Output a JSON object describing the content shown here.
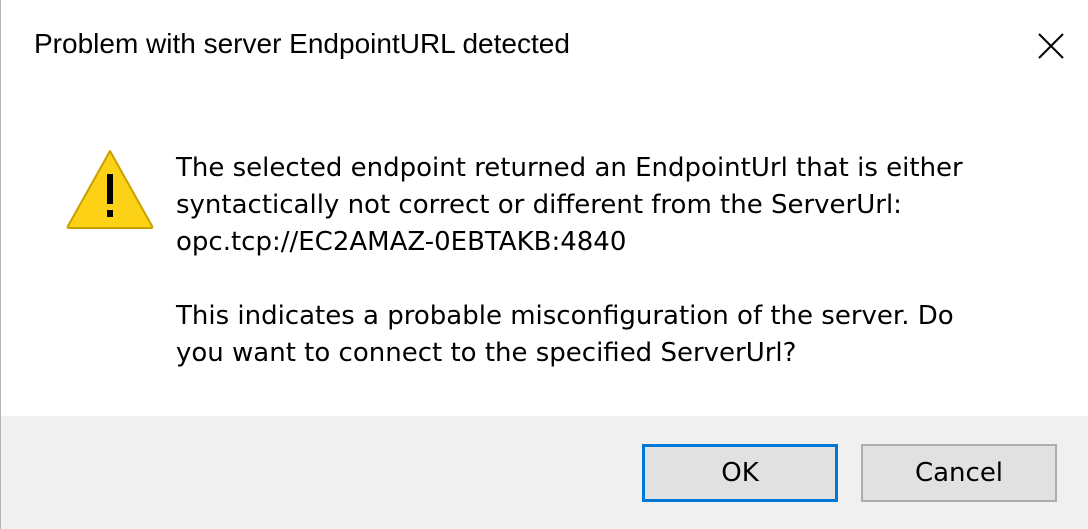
{
  "window": {
    "title": "Problem with server EndpointURL detected",
    "close_icon": "close-icon"
  },
  "message": {
    "icon": "warning-icon",
    "paragraph1": "The selected endpoint returned an EndpointUrl that is either\nsyntactically not correct or different from the ServerUrl:\nopc.tcp://EC2AMAZ-0EBTAKB:4840",
    "paragraph2": "This indicates a probable misconfiguration of the server.  Do\nyou want to connect to the specified ServerUrl?"
  },
  "buttons": {
    "ok_label": "OK",
    "cancel_label": "Cancel"
  },
  "colors": {
    "accent": "#0078d7",
    "warning_fill": "#fcd116",
    "warning_stroke": "#c8a000"
  }
}
